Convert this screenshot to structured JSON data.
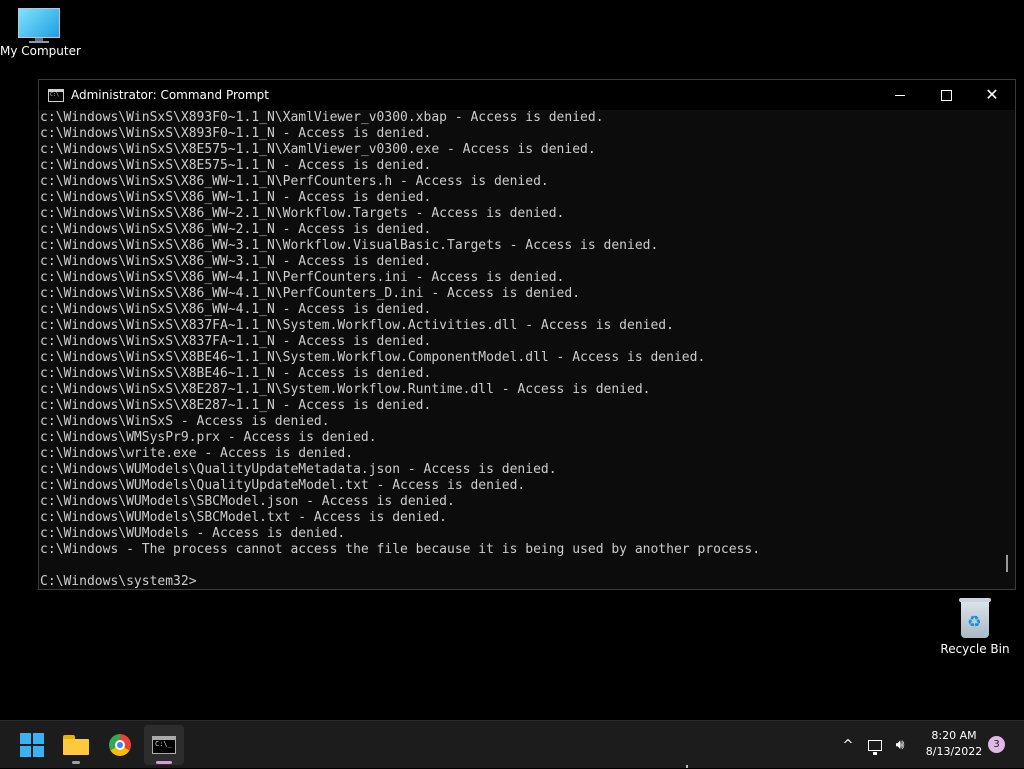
{
  "desktop": {
    "my_computer_label": "My Computer",
    "recycle_bin_label": "Recycle Bin"
  },
  "window": {
    "title": "Administrator: Command Prompt",
    "controls": {
      "minimize": "minimize-icon",
      "maximize": "maximize-icon",
      "close": "close-icon"
    },
    "lines": [
      "c:\\Windows\\WinSxS\\X893F0~1.1_N\\XamlViewer_v0300.xbap - Access is denied.",
      "c:\\Windows\\WinSxS\\X893F0~1.1_N - Access is denied.",
      "c:\\Windows\\WinSxS\\X8E575~1.1_N\\XamlViewer_v0300.exe - Access is denied.",
      "c:\\Windows\\WinSxS\\X8E575~1.1_N - Access is denied.",
      "c:\\Windows\\WinSxS\\X86_WW~1.1_N\\PerfCounters.h - Access is denied.",
      "c:\\Windows\\WinSxS\\X86_WW~1.1_N - Access is denied.",
      "c:\\Windows\\WinSxS\\X86_WW~2.1_N\\Workflow.Targets - Access is denied.",
      "c:\\Windows\\WinSxS\\X86_WW~2.1_N - Access is denied.",
      "c:\\Windows\\WinSxS\\X86_WW~3.1_N\\Workflow.VisualBasic.Targets - Access is denied.",
      "c:\\Windows\\WinSxS\\X86_WW~3.1_N - Access is denied.",
      "c:\\Windows\\WinSxS\\X86_WW~4.1_N\\PerfCounters.ini - Access is denied.",
      "c:\\Windows\\WinSxS\\X86_WW~4.1_N\\PerfCounters_D.ini - Access is denied.",
      "c:\\Windows\\WinSxS\\X86_WW~4.1_N - Access is denied.",
      "c:\\Windows\\WinSxS\\X837FA~1.1_N\\System.Workflow.Activities.dll - Access is denied.",
      "c:\\Windows\\WinSxS\\X837FA~1.1_N - Access is denied.",
      "c:\\Windows\\WinSxS\\X8BE46~1.1_N\\System.Workflow.ComponentModel.dll - Access is denied.",
      "c:\\Windows\\WinSxS\\X8BE46~1.1_N - Access is denied.",
      "c:\\Windows\\WinSxS\\X8E287~1.1_N\\System.Workflow.Runtime.dll - Access is denied.",
      "c:\\Windows\\WinSxS\\X8E287~1.1_N - Access is denied.",
      "c:\\Windows\\WinSxS - Access is denied.",
      "c:\\Windows\\WMSysPr9.prx - Access is denied.",
      "c:\\Windows\\write.exe - Access is denied.",
      "c:\\Windows\\WUModels\\QualityUpdateMetadata.json - Access is denied.",
      "c:\\Windows\\WUModels\\QualityUpdateModel.txt - Access is denied.",
      "c:\\Windows\\WUModels\\SBCModel.json - Access is denied.",
      "c:\\Windows\\WUModels\\SBCModel.txt - Access is denied.",
      "c:\\Windows\\WUModels - Access is denied.",
      "c:\\Windows - The process cannot access the file because it is being used by another process.",
      "",
      "C:\\Windows\\system32>"
    ]
  },
  "taskbar": {
    "apps": [
      "start",
      "file-explorer",
      "chrome",
      "command-prompt"
    ],
    "time": "8:20 AM",
    "date": "8/13/2022",
    "notification_count": "3",
    "tray_chevron": "^"
  },
  "colors": {
    "console_bg": "#0c0c0c",
    "console_text": "#cccccc",
    "taskbar_bg": "#1c1c1c",
    "accent": "#3bb1f2"
  }
}
